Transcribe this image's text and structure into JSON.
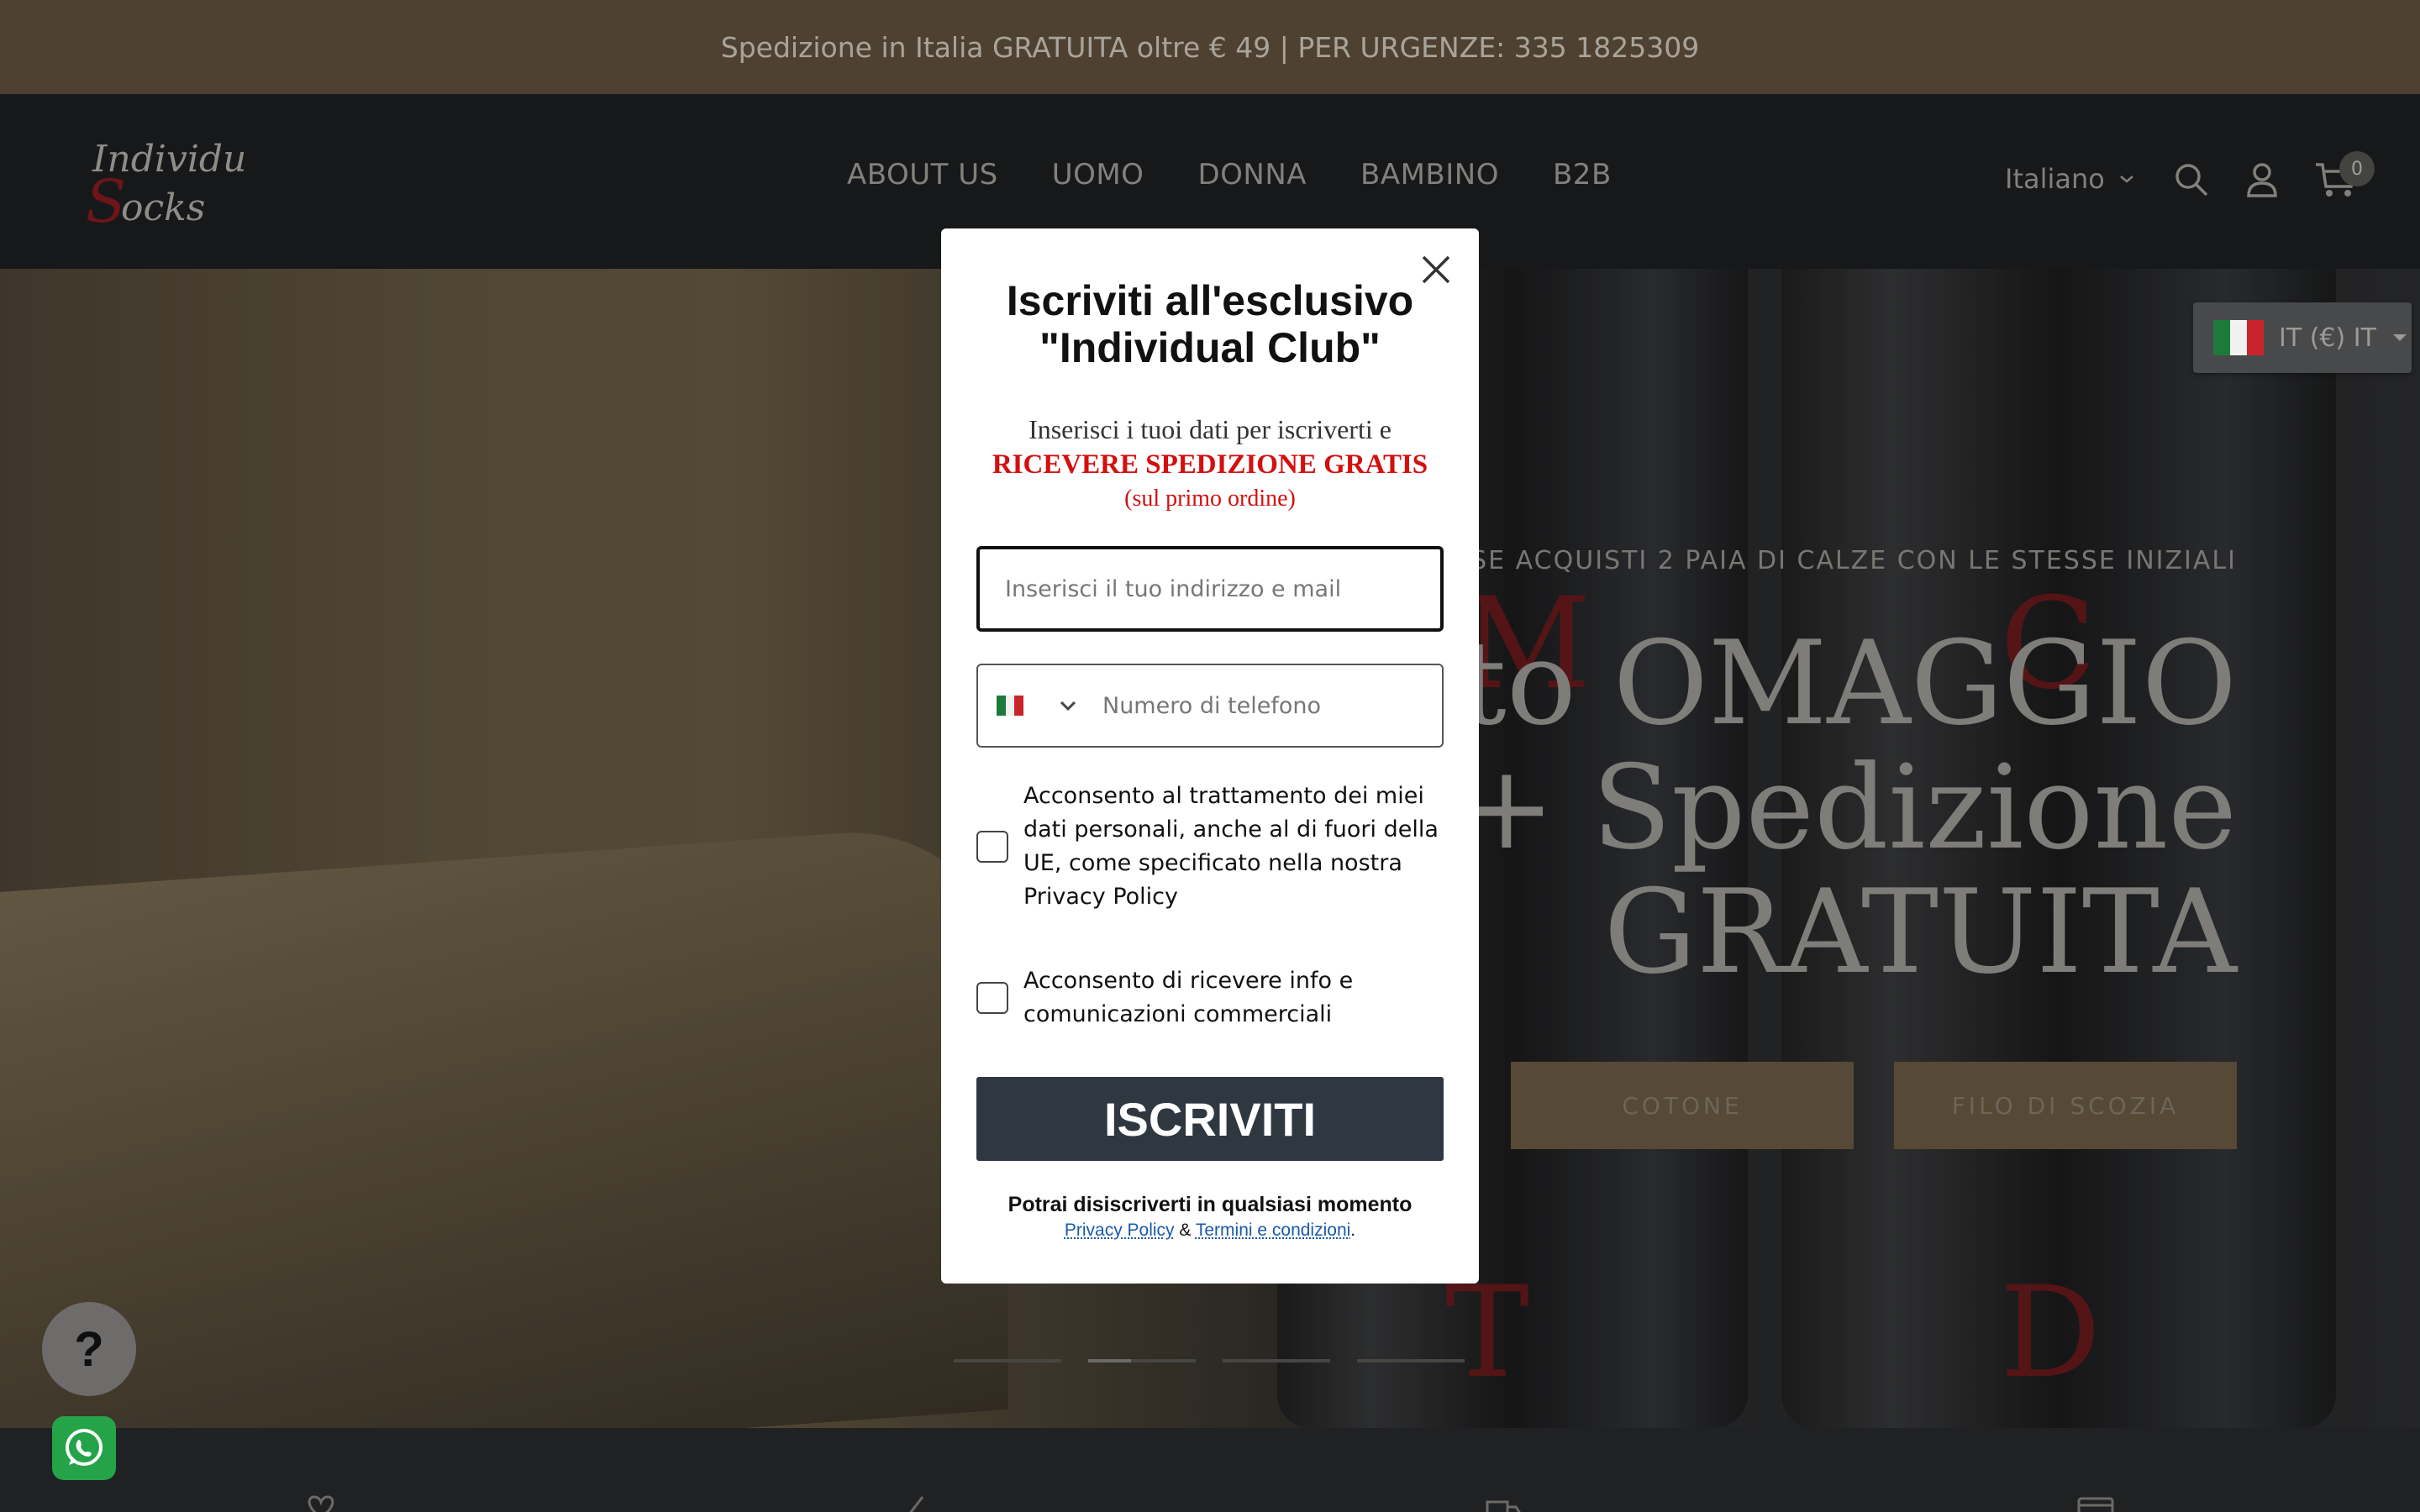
{
  "announcement": "Spedizione in Italia GRATUITA oltre € 49 | PER URGENZE: 335 1825309",
  "header": {
    "logo_text_1": "Individual",
    "logo_text_2": "Socks",
    "nav": [
      "ABOUT US",
      "UOMO",
      "DONNA",
      "BAMBINO",
      "B2B"
    ],
    "language": "Italiano",
    "cart_count": "0"
  },
  "currency_selector": {
    "label": "IT (€) IT"
  },
  "hero": {
    "kicker": "SE ACQUISTI 2 PAIA DI CALZE CON LE STESSE INIZIALI",
    "title_line1": "etto OMAGGIO",
    "title_line2": "+ Spedizione",
    "title_line3": "GRATUITA",
    "buttons": [
      "COTONE",
      "FILO DI SCOZIA"
    ],
    "slides": 4,
    "active_slide": 2,
    "jar_letters": [
      "M",
      "C",
      "T",
      "D"
    ]
  },
  "modal": {
    "title_line1": "Iscriviti all'esclusivo",
    "title_line2": "\"Individual Club\"",
    "sub_line1": "Inserisci i tuoi dati per iscriverti e",
    "sub_line2": "RICEVERE SPEDIZIONE GRATIS",
    "sub_line3": "(sul primo ordine)",
    "email_placeholder": "Inserisci il tuo indirizzo e mail",
    "phone_placeholder": "Numero di telefono",
    "consent_privacy": "Acconsento al trattamento dei miei dati personali, anche al di fuori della UE, come specificato nella nostra Privacy Policy",
    "consent_marketing": "Acconsento di ricevere info e comunicazioni commerciali",
    "submit": "ISCRIVITI",
    "footer_line": "Potrai disiscriverti in qualsiasi momento",
    "privacy_link": "Privacy Policy",
    "ampersand": "&",
    "terms_link": "Termini e condizioni",
    "period": "."
  },
  "widgets": {
    "help": "?"
  },
  "colors": {
    "announcement_bg": "#665440",
    "header_bg": "#1e1f21",
    "accent_red": "#d40f0f",
    "submit_bg": "#2f3841",
    "hero_button_bg": "#6f5e45"
  }
}
